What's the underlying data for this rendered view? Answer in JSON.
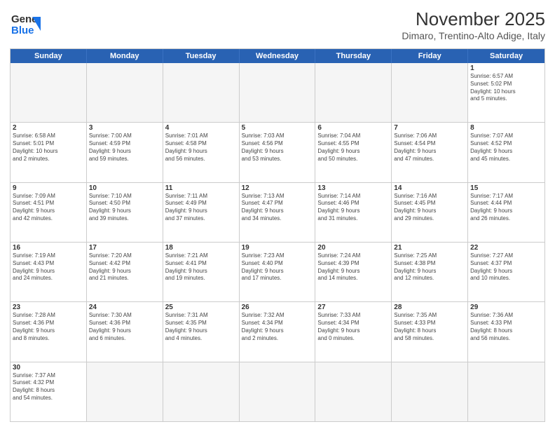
{
  "header": {
    "logo_general": "General",
    "logo_blue": "Blue",
    "month_year": "November 2025",
    "location": "Dimaro, Trentino-Alto Adige, Italy"
  },
  "day_headers": [
    "Sunday",
    "Monday",
    "Tuesday",
    "Wednesday",
    "Thursday",
    "Friday",
    "Saturday"
  ],
  "weeks": [
    [
      {
        "day": "",
        "info": ""
      },
      {
        "day": "",
        "info": ""
      },
      {
        "day": "",
        "info": ""
      },
      {
        "day": "",
        "info": ""
      },
      {
        "day": "",
        "info": ""
      },
      {
        "day": "",
        "info": ""
      },
      {
        "day": "1",
        "info": "Sunrise: 6:57 AM\nSunset: 5:02 PM\nDaylight: 10 hours\nand 5 minutes."
      }
    ],
    [
      {
        "day": "2",
        "info": "Sunrise: 6:58 AM\nSunset: 5:01 PM\nDaylight: 10 hours\nand 2 minutes."
      },
      {
        "day": "3",
        "info": "Sunrise: 7:00 AM\nSunset: 4:59 PM\nDaylight: 9 hours\nand 59 minutes."
      },
      {
        "day": "4",
        "info": "Sunrise: 7:01 AM\nSunset: 4:58 PM\nDaylight: 9 hours\nand 56 minutes."
      },
      {
        "day": "5",
        "info": "Sunrise: 7:03 AM\nSunset: 4:56 PM\nDaylight: 9 hours\nand 53 minutes."
      },
      {
        "day": "6",
        "info": "Sunrise: 7:04 AM\nSunset: 4:55 PM\nDaylight: 9 hours\nand 50 minutes."
      },
      {
        "day": "7",
        "info": "Sunrise: 7:06 AM\nSunset: 4:54 PM\nDaylight: 9 hours\nand 47 minutes."
      },
      {
        "day": "8",
        "info": "Sunrise: 7:07 AM\nSunset: 4:52 PM\nDaylight: 9 hours\nand 45 minutes."
      }
    ],
    [
      {
        "day": "9",
        "info": "Sunrise: 7:09 AM\nSunset: 4:51 PM\nDaylight: 9 hours\nand 42 minutes."
      },
      {
        "day": "10",
        "info": "Sunrise: 7:10 AM\nSunset: 4:50 PM\nDaylight: 9 hours\nand 39 minutes."
      },
      {
        "day": "11",
        "info": "Sunrise: 7:11 AM\nSunset: 4:49 PM\nDaylight: 9 hours\nand 37 minutes."
      },
      {
        "day": "12",
        "info": "Sunrise: 7:13 AM\nSunset: 4:47 PM\nDaylight: 9 hours\nand 34 minutes."
      },
      {
        "day": "13",
        "info": "Sunrise: 7:14 AM\nSunset: 4:46 PM\nDaylight: 9 hours\nand 31 minutes."
      },
      {
        "day": "14",
        "info": "Sunrise: 7:16 AM\nSunset: 4:45 PM\nDaylight: 9 hours\nand 29 minutes."
      },
      {
        "day": "15",
        "info": "Sunrise: 7:17 AM\nSunset: 4:44 PM\nDaylight: 9 hours\nand 26 minutes."
      }
    ],
    [
      {
        "day": "16",
        "info": "Sunrise: 7:19 AM\nSunset: 4:43 PM\nDaylight: 9 hours\nand 24 minutes."
      },
      {
        "day": "17",
        "info": "Sunrise: 7:20 AM\nSunset: 4:42 PM\nDaylight: 9 hours\nand 21 minutes."
      },
      {
        "day": "18",
        "info": "Sunrise: 7:21 AM\nSunset: 4:41 PM\nDaylight: 9 hours\nand 19 minutes."
      },
      {
        "day": "19",
        "info": "Sunrise: 7:23 AM\nSunset: 4:40 PM\nDaylight: 9 hours\nand 17 minutes."
      },
      {
        "day": "20",
        "info": "Sunrise: 7:24 AM\nSunset: 4:39 PM\nDaylight: 9 hours\nand 14 minutes."
      },
      {
        "day": "21",
        "info": "Sunrise: 7:25 AM\nSunset: 4:38 PM\nDaylight: 9 hours\nand 12 minutes."
      },
      {
        "day": "22",
        "info": "Sunrise: 7:27 AM\nSunset: 4:37 PM\nDaylight: 9 hours\nand 10 minutes."
      }
    ],
    [
      {
        "day": "23",
        "info": "Sunrise: 7:28 AM\nSunset: 4:36 PM\nDaylight: 9 hours\nand 8 minutes."
      },
      {
        "day": "24",
        "info": "Sunrise: 7:30 AM\nSunset: 4:36 PM\nDaylight: 9 hours\nand 6 minutes."
      },
      {
        "day": "25",
        "info": "Sunrise: 7:31 AM\nSunset: 4:35 PM\nDaylight: 9 hours\nand 4 minutes."
      },
      {
        "day": "26",
        "info": "Sunrise: 7:32 AM\nSunset: 4:34 PM\nDaylight: 9 hours\nand 2 minutes."
      },
      {
        "day": "27",
        "info": "Sunrise: 7:33 AM\nSunset: 4:34 PM\nDaylight: 9 hours\nand 0 minutes."
      },
      {
        "day": "28",
        "info": "Sunrise: 7:35 AM\nSunset: 4:33 PM\nDaylight: 8 hours\nand 58 minutes."
      },
      {
        "day": "29",
        "info": "Sunrise: 7:36 AM\nSunset: 4:33 PM\nDaylight: 8 hours\nand 56 minutes."
      }
    ],
    [
      {
        "day": "30",
        "info": "Sunrise: 7:37 AM\nSunset: 4:32 PM\nDaylight: 8 hours\nand 54 minutes."
      },
      {
        "day": "",
        "info": ""
      },
      {
        "day": "",
        "info": ""
      },
      {
        "day": "",
        "info": ""
      },
      {
        "day": "",
        "info": ""
      },
      {
        "day": "",
        "info": ""
      },
      {
        "day": "",
        "info": ""
      }
    ]
  ]
}
